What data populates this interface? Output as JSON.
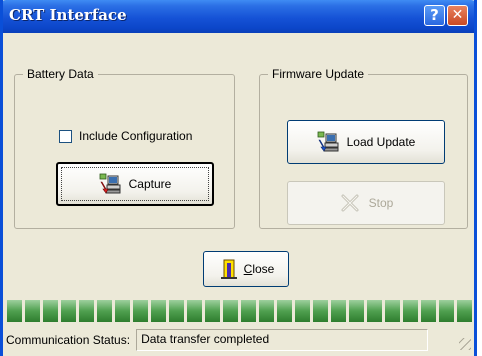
{
  "window": {
    "title": "CRT Interface",
    "help_label": "?",
    "close_label": "✕"
  },
  "battery": {
    "legend": "Battery Data",
    "include_config_label": "Include Configuration",
    "include_config_checked": false,
    "capture_label": "Capture"
  },
  "firmware": {
    "legend": "Firmware Update",
    "load_label": "Load Update",
    "stop_label": "Stop"
  },
  "close_button": {
    "label": "Close"
  },
  "progress": {
    "fraction": 1.0
  },
  "status": {
    "label": "Communication Status:",
    "value": "Data transfer completed"
  }
}
